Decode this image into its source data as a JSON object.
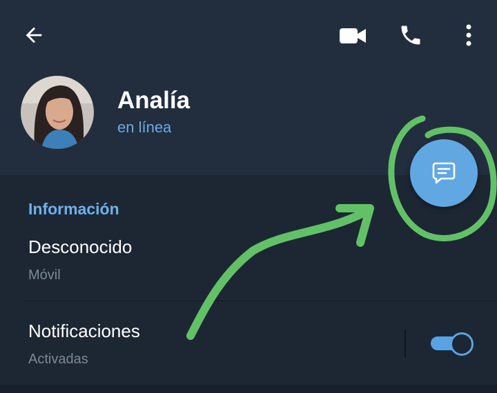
{
  "header": {
    "back_icon": "arrow-left-icon",
    "video_icon": "video-camera-icon",
    "call_icon": "phone-icon",
    "menu_icon": "more-vertical-icon"
  },
  "profile": {
    "name": "Analía",
    "status": "en línea",
    "avatar": "profile-photo"
  },
  "fab": {
    "icon": "message-icon"
  },
  "info": {
    "section_title": "Información",
    "phone_value": "Desconocido",
    "phone_label": "Móvil",
    "notifications_label": "Notificaciones",
    "notifications_value": "Activadas",
    "notifications_enabled": true
  },
  "annotation": {
    "stroke_color": "#62c167",
    "shapes": [
      "circle-highlight",
      "arrow"
    ]
  },
  "colors": {
    "header_bg": "#222e3d",
    "panel_bg": "#1d2733",
    "accent": "#61a8e3",
    "status_text": "#6fa9e6",
    "muted_text": "#7b8896"
  }
}
